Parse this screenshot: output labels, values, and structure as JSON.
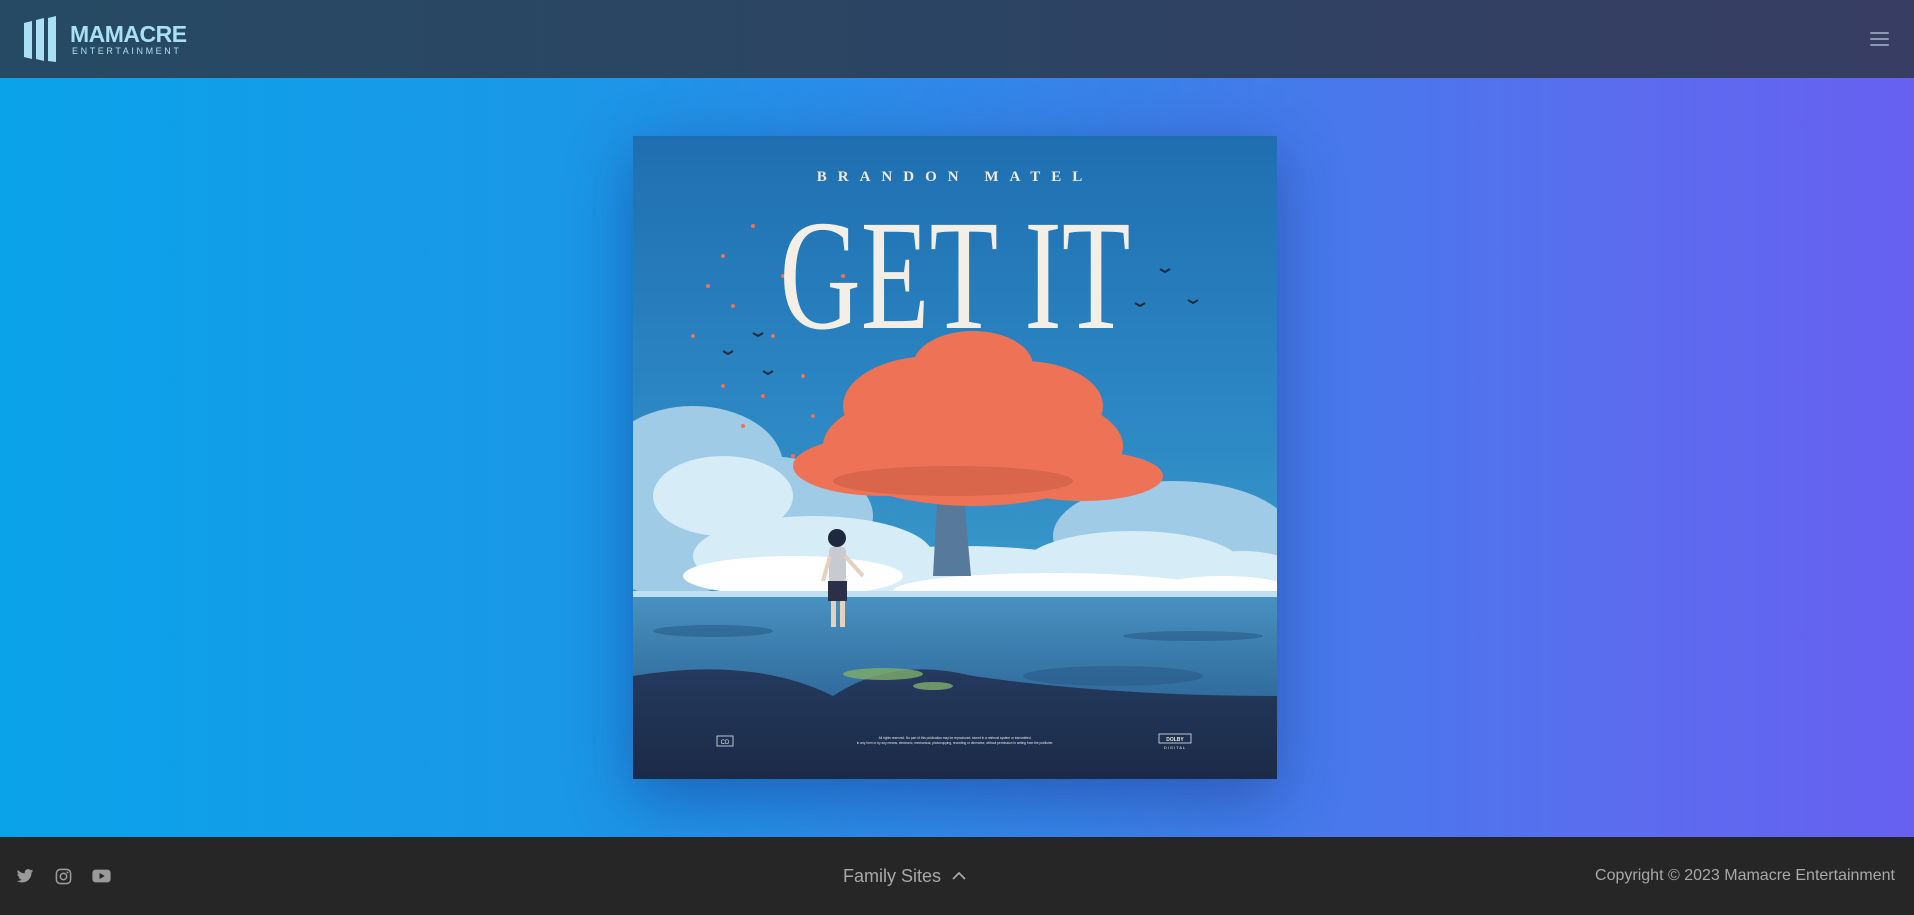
{
  "header": {
    "logo_name": "MAMACRE",
    "logo_sub": "ENTERTAINMENT",
    "menu_icon": "hamburger-menu-icon"
  },
  "album": {
    "artist": "BRANDON MATEL",
    "title": "GET IT",
    "fine_print_line1": "All rights reserved. No part of this publication may be reproduced, stored in a retrieval system or transmitted,",
    "fine_print_line2": "in any form or by any means, electronic, mechanical, photocopying, recording or otherwise, without permission in writing from the publisher.",
    "badge_left": "CD",
    "badge_right_top": "DOLBY",
    "badge_right_bottom": "DIGITAL"
  },
  "footer": {
    "social_icons": [
      "twitter-icon",
      "instagram-icon",
      "youtube-icon"
    ],
    "family_sites_label": "Family Sites",
    "copyright": "Copyright © 2023 Mamacre Entertainment"
  },
  "colors": {
    "header_bg": "#2c4463",
    "footer_bg": "#262626",
    "logo": "#a9e0f6",
    "tree": "#ee7356",
    "footer_text": "#a8a8a8"
  }
}
